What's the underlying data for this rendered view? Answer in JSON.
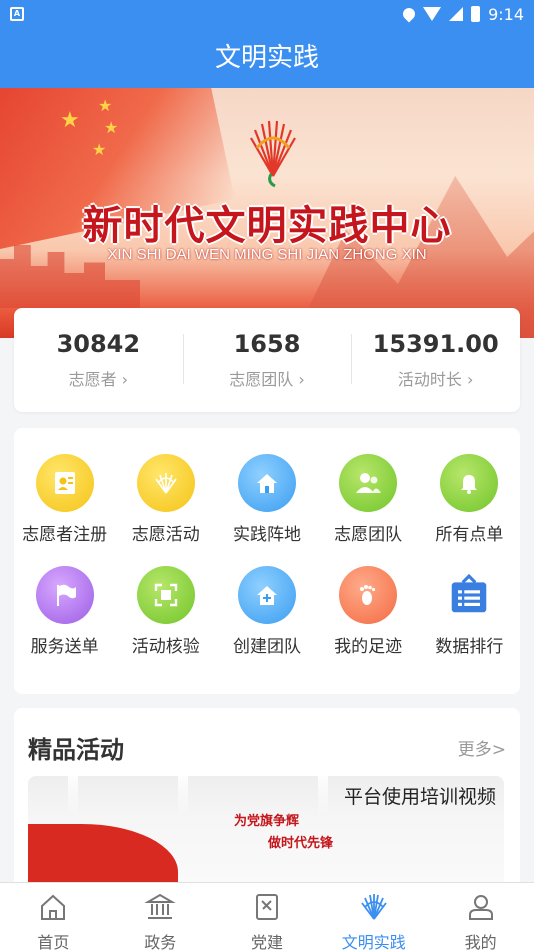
{
  "status_bar": {
    "time": "9:14",
    "app_badge": "A"
  },
  "header": {
    "title": "文明实践"
  },
  "banner": {
    "title": "新时代文明实践中心",
    "pinyin": "XIN SHI DAI WEN MING SHI JIAN ZHONG XIN"
  },
  "stats": [
    {
      "value": "30842",
      "label": "志愿者 ›"
    },
    {
      "value": "1658",
      "label": "志愿团队 ›"
    },
    {
      "value": "15391.00",
      "label": "活动时长 ›"
    }
  ],
  "functions": [
    {
      "label": "志愿者注册",
      "icon": "id-card-icon",
      "color": "#f5c316"
    },
    {
      "label": "志愿活动",
      "icon": "fan-logo-icon",
      "color": "#f5c316"
    },
    {
      "label": "实践阵地",
      "icon": "home-icon",
      "color": "#3a9df0"
    },
    {
      "label": "志愿团队",
      "icon": "team-icon",
      "color": "#71c52a"
    },
    {
      "label": "所有点单",
      "icon": "bell-icon",
      "color": "#71c52a"
    },
    {
      "label": "服务送单",
      "icon": "flag-icon",
      "color": "#9c5de4"
    },
    {
      "label": "活动核验",
      "icon": "scan-icon",
      "color": "#71c52a"
    },
    {
      "label": "创建团队",
      "icon": "add-home-icon",
      "color": "#3a9df0"
    },
    {
      "label": "我的足迹",
      "icon": "footprint-icon",
      "color": "#f36a42"
    },
    {
      "label": "数据排行",
      "icon": "list-icon",
      "color": "#3a7fe0"
    }
  ],
  "featured": {
    "title": "精品活动",
    "more": "更多>",
    "card": {
      "video_title": "平台使用培训视频",
      "slogan_1": "为党旗争辉",
      "slogan_2": "做时代先锋"
    }
  },
  "bottom_nav": [
    {
      "label": "首页",
      "icon": "home-outline-icon",
      "active": false
    },
    {
      "label": "政务",
      "icon": "government-icon",
      "active": false
    },
    {
      "label": "党建",
      "icon": "party-book-icon",
      "active": false
    },
    {
      "label": "文明实践",
      "icon": "fan-logo-icon",
      "active": true
    },
    {
      "label": "我的",
      "icon": "user-icon",
      "active": false
    }
  ],
  "colors": {
    "primary": "#3b8ff0",
    "banner_red": "#c4161c"
  }
}
